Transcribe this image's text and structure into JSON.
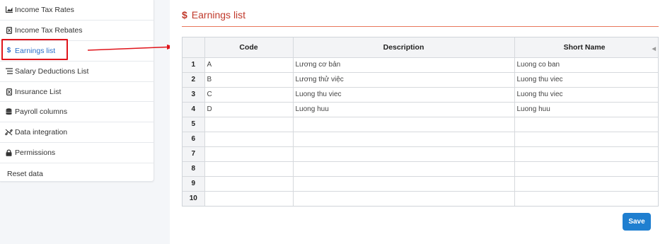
{
  "sidebar": {
    "items": [
      {
        "icon": "chart-icon",
        "glyph": "📈",
        "label": "Income Tax Rates"
      },
      {
        "icon": "calculator-icon",
        "glyph": "▣",
        "label": "Income Tax Rebates"
      },
      {
        "icon": "dollar-icon",
        "glyph": "$",
        "label": "Earnings list",
        "active": true
      },
      {
        "icon": "list-icon",
        "glyph": "☰",
        "label": "Salary Deductions List"
      },
      {
        "icon": "calculator-icon",
        "glyph": "▣",
        "label": "Insurance List"
      },
      {
        "icon": "database-icon",
        "glyph": "◎",
        "label": "Payroll columns"
      },
      {
        "icon": "link-icon",
        "glyph": "⚭",
        "label": "Data integration"
      },
      {
        "icon": "lock-icon",
        "glyph": "🔒",
        "label": "Permissions"
      },
      {
        "icon": "",
        "glyph": "",
        "label": "Reset data"
      }
    ]
  },
  "panel": {
    "title_icon": "$",
    "title": "Earnings list"
  },
  "grid": {
    "columns": [
      "Code",
      "Description",
      "Short Name"
    ],
    "rows": [
      {
        "num": "1",
        "code": "A",
        "description": "Lương cơ bản",
        "short_name": "Luong co ban"
      },
      {
        "num": "2",
        "code": "B",
        "description": "Lương thử việc",
        "short_name": "Luong thu viec"
      },
      {
        "num": "3",
        "code": "C",
        "description": "Luong thu viec",
        "short_name": "Luong thu viec"
      },
      {
        "num": "4",
        "code": "D",
        "description": "Luong huu",
        "short_name": "Luong huu"
      },
      {
        "num": "5",
        "code": "",
        "description": "",
        "short_name": ""
      },
      {
        "num": "6",
        "code": "",
        "description": "",
        "short_name": ""
      },
      {
        "num": "7",
        "code": "",
        "description": "",
        "short_name": ""
      },
      {
        "num": "8",
        "code": "",
        "description": "",
        "short_name": ""
      },
      {
        "num": "9",
        "code": "",
        "description": "",
        "short_name": ""
      },
      {
        "num": "10",
        "code": "",
        "description": "",
        "short_name": ""
      }
    ]
  },
  "actions": {
    "save_label": "Save"
  },
  "colors": {
    "accent_blue": "#1f7fd0",
    "title_red": "#c0392b",
    "highlight_red": "#e0141b"
  }
}
